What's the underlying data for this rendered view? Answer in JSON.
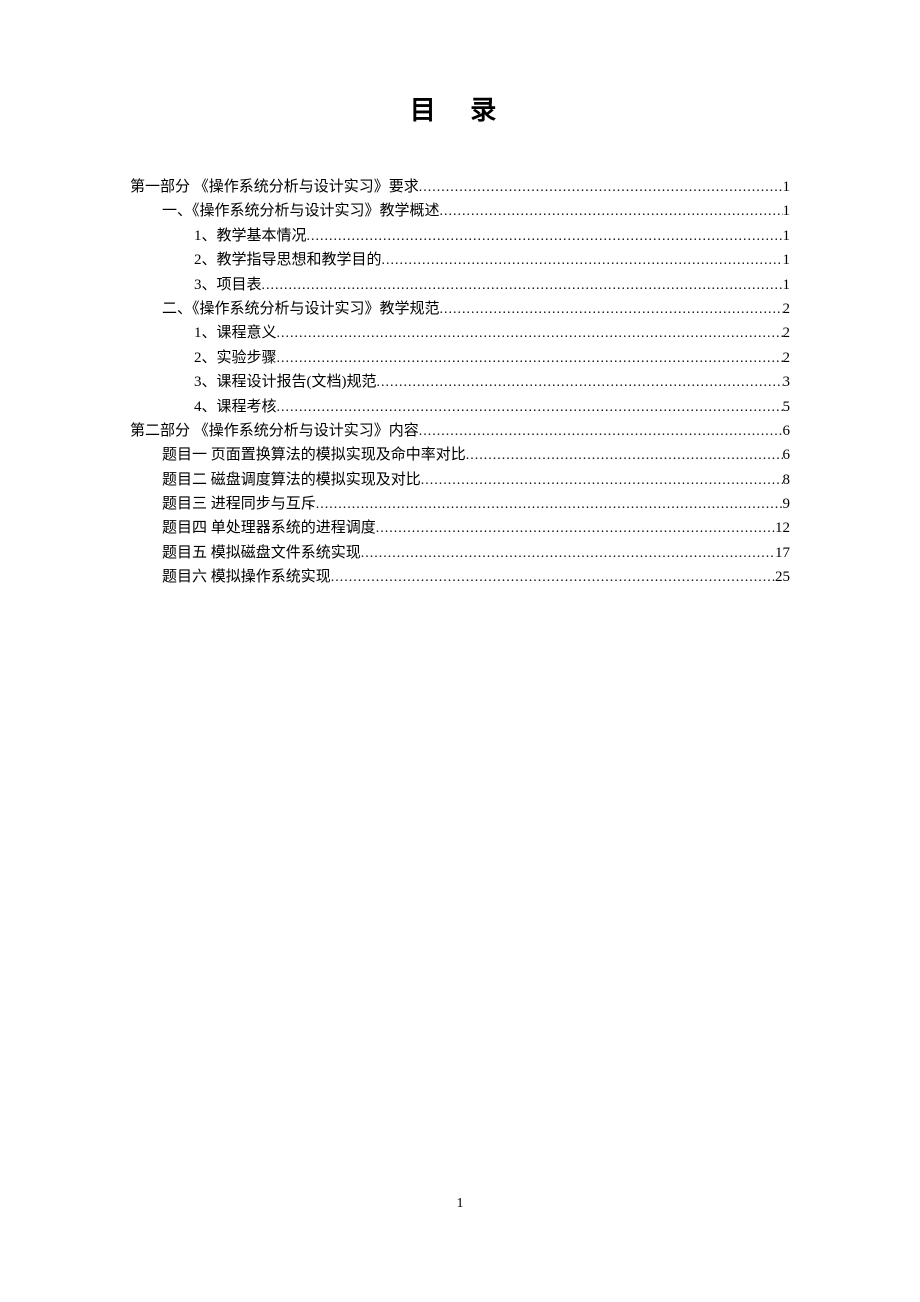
{
  "title": "目 录",
  "entries": [
    {
      "indent": 0,
      "label": "第一部分  《操作系统分析与设计实习》要求 ",
      "page": "1"
    },
    {
      "indent": 1,
      "label": "一、《操作系统分析与设计实习》教学概述 ",
      "page": "1"
    },
    {
      "indent": 2,
      "label": "1、教学基本情况",
      "page": "1"
    },
    {
      "indent": 2,
      "label": "2、教学指导思想和教学目的",
      "page": "1"
    },
    {
      "indent": 2,
      "label": "3、项目表",
      "page": "1"
    },
    {
      "indent": 1,
      "label": "二、《操作系统分析与设计实习》教学规范 ",
      "page": "2"
    },
    {
      "indent": 2,
      "label": "1、课程意义",
      "page": "2"
    },
    {
      "indent": 2,
      "label": "2、实验步骤",
      "page": "2"
    },
    {
      "indent": 2,
      "label": "3、课程设计报告(文档)规范 ",
      "page": "3"
    },
    {
      "indent": 2,
      "label": "4、课程考核",
      "page": "5"
    },
    {
      "indent": 0,
      "label": "第二部分  《操作系统分析与设计实习》内容 ",
      "page": "6"
    },
    {
      "indent": 1,
      "label": "题目一  页面置换算法的模拟实现及命中率对比 ",
      "page": "6"
    },
    {
      "indent": 1,
      "label": "题目二  磁盘调度算法的模拟实现及对比",
      "page": "8"
    },
    {
      "indent": 1,
      "label": "题目三  进程同步与互斥",
      "page": "9"
    },
    {
      "indent": 1,
      "label": "题目四  单处理器系统的进程调度",
      "page": "12"
    },
    {
      "indent": 1,
      "label": "题目五  模拟磁盘文件系统实现",
      "page": "17"
    },
    {
      "indent": 1,
      "label": "题目六  模拟操作系统实现",
      "page": "25"
    }
  ],
  "pageNumber": "1"
}
